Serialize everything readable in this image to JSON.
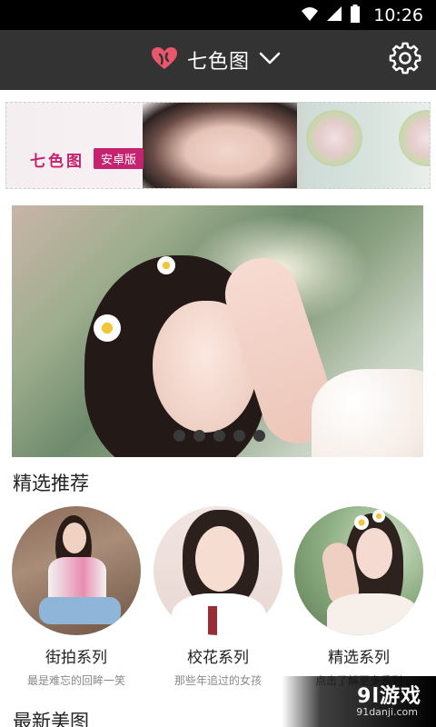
{
  "status_bar": {
    "time": "10:26",
    "icons": [
      "wifi-icon",
      "signal-icon",
      "battery-icon"
    ]
  },
  "app_bar": {
    "title": "七色图",
    "logo_icon": "heart-logo-icon",
    "dropdown_icon": "chevron-down-icon",
    "settings_icon": "gear-icon",
    "background_color": "#333333"
  },
  "banner": {
    "brand_text": "七色图",
    "badge_text": "安卓版",
    "accent_color": "#c5226f"
  },
  "carousel": {
    "slide_count": 5,
    "active_index": 0
  },
  "featured": {
    "title": "精选推荐",
    "items": [
      {
        "title": "街拍系列",
        "subtitle": "最是难忘的回眸一笑"
      },
      {
        "title": "校花系列",
        "subtitle": "那些年追过的女孩"
      },
      {
        "title": "精选系列",
        "subtitle": "点击了解更多系列"
      }
    ]
  },
  "latest": {
    "title": "最新美图"
  },
  "watermark": {
    "main": "9l游戏",
    "sub": "91danji.com"
  }
}
